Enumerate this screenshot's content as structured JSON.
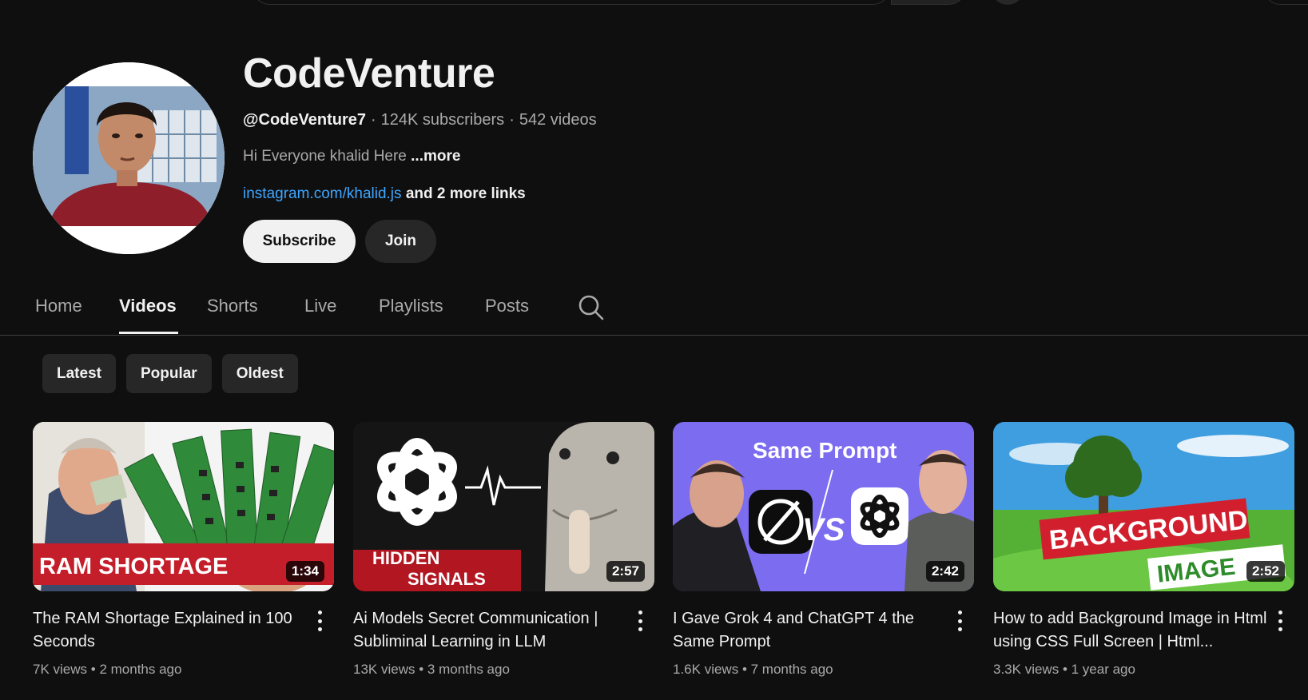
{
  "channel": {
    "name": "CodeVenture",
    "handle": "@CodeVenture7",
    "subscribers": "124K subscribers",
    "videos_count": "542 videos",
    "separator": "·",
    "description": "Hi Everyone khalid Here",
    "more_label": "...more",
    "link": "instagram.com/khalid.js",
    "more_links": "and 2 more links",
    "subscribe_label": "Subscribe",
    "join_label": "Join"
  },
  "tabs": [
    {
      "label": "Home"
    },
    {
      "label": "Videos"
    },
    {
      "label": "Shorts"
    },
    {
      "label": "Live"
    },
    {
      "label": "Playlists"
    },
    {
      "label": "Posts"
    }
  ],
  "active_tab": "Videos",
  "chips": [
    {
      "label": "Latest"
    },
    {
      "label": "Popular"
    },
    {
      "label": "Oldest"
    }
  ],
  "videos": [
    {
      "title": "The RAM Shortage Explained in 100 Seconds",
      "views": "7K views",
      "age": "2 months ago",
      "duration": "1:34",
      "thumb_text": "RAM SHORTAGE"
    },
    {
      "title": "Ai Models Secret Communication | Subliminal Learning in LLM",
      "views": "13K views",
      "age": "3 months ago",
      "duration": "2:57",
      "thumb_text_1": "HIDDEN",
      "thumb_text_2": "SIGNALS"
    },
    {
      "title": "I Gave Grok 4 and ChatGPT 4 the Same Prompt",
      "views": "1.6K views",
      "age": "7 months ago",
      "duration": "2:42",
      "thumb_text": "Same Prompt",
      "vs": "VS"
    },
    {
      "title": "How to add Background Image in Html using CSS Full Screen | Html...",
      "views": "3.3K views",
      "age": "1 year ago",
      "duration": "2:52",
      "thumb_text_1": "BACKGROUND",
      "thumb_text_2": "IMAGE"
    }
  ],
  "stats_separator": "•",
  "colors": {
    "background": "#0f0f0f",
    "link": "#3ea6ff",
    "chip": "#272727"
  }
}
